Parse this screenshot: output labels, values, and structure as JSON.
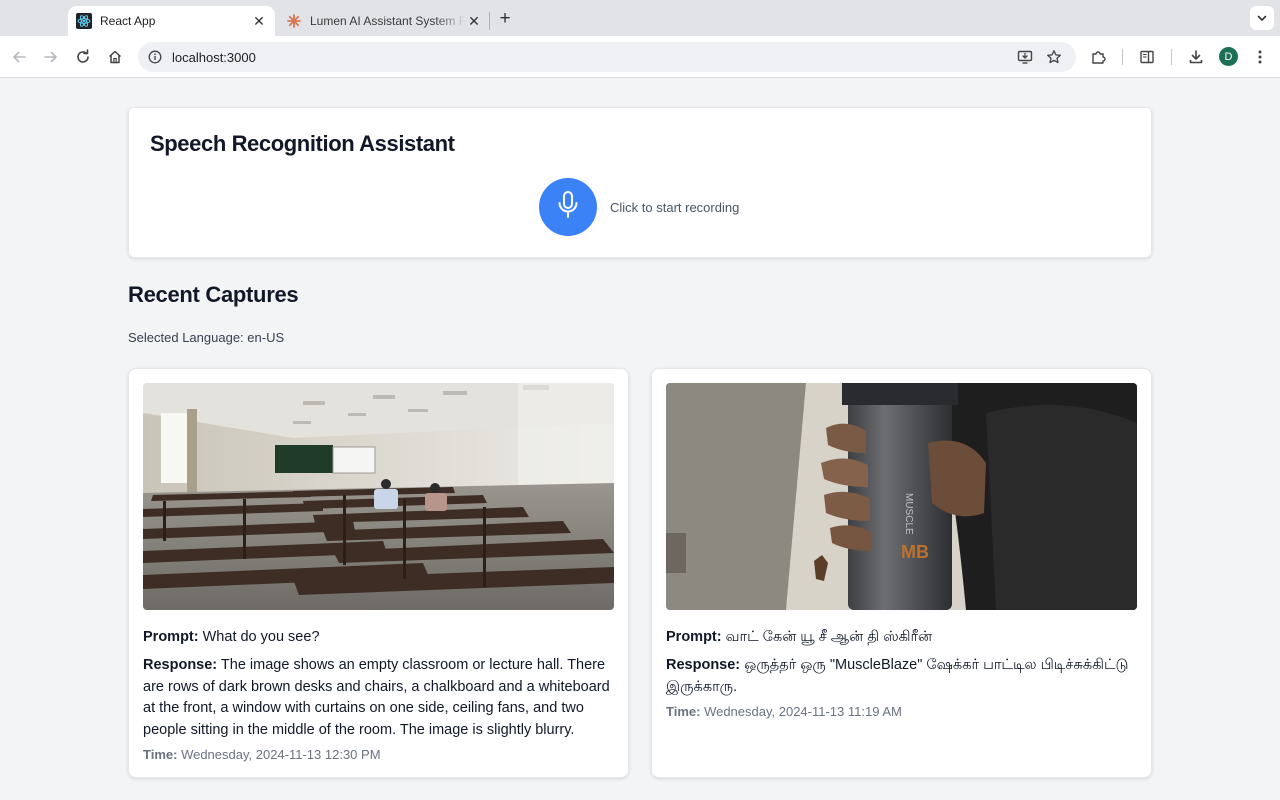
{
  "browser": {
    "tabs": [
      {
        "title": "React App",
        "active": true
      },
      {
        "title": "Lumen AI Assistant System Flow",
        "active": false
      }
    ],
    "address_bar": {
      "url": "localhost:3000"
    },
    "profile_initial": "D",
    "colors": {
      "profile": "#1b6f54",
      "react_logo": "#61dafb",
      "claude_logo": "#d97757"
    }
  },
  "app": {
    "title": "Speech Recognition Assistant",
    "mic_hint": "Click to start recording",
    "mic_color": "#3b82f6"
  },
  "captures_section": {
    "title": "Recent Captures",
    "language_label": "Selected Language:",
    "language_value": "en-US",
    "labels": {
      "prompt": "Prompt:",
      "response": "Response:",
      "time": "Time:"
    },
    "items": [
      {
        "image_icon": "classroom-photo",
        "prompt": "What do you see?",
        "response": "The image shows an empty classroom or lecture hall. There are rows of dark brown desks and chairs, a chalkboard and a whiteboard at the front, a window with curtains on one side, ceiling fans, and two people sitting in the middle of the room. The image is slightly blurry.",
        "time": "Wednesday, 2024-11-13 12:30 PM"
      },
      {
        "image_icon": "shaker-bottle-photo",
        "prompt": "வாட் கேன் யூ சீ ஆன் தி ஸ்கிரீன்",
        "response": "ஒருத்தர் ஒரு \"MuscleBlaze\" ஷேக்கர் பாட்டில பிடிச்சுக்கிட்டு இருக்காரு.",
        "time": "Wednesday, 2024-11-13 11:19 AM"
      }
    ]
  }
}
